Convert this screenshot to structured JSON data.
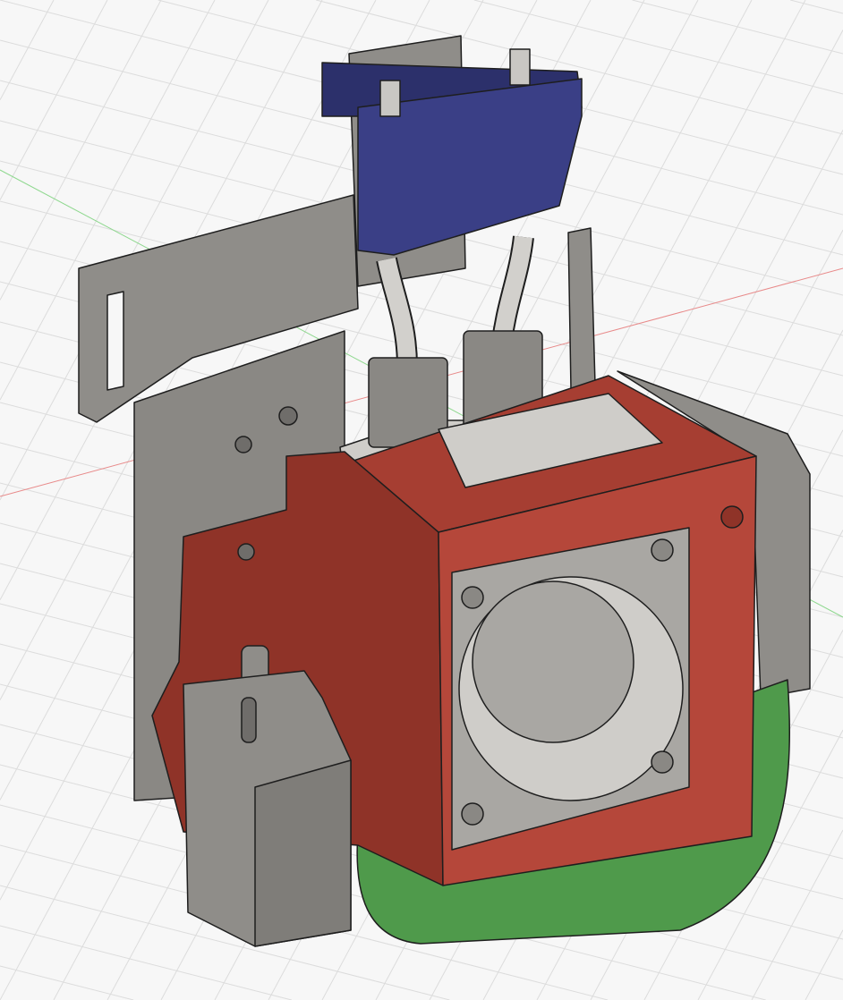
{
  "viewport": {
    "background": "#f7f7f7",
    "grid_color": "#dcdcdc",
    "x_axis_color": "#e88a8a",
    "y_axis_color": "#8fd88f"
  },
  "model": {
    "colors": {
      "plate_grey": "#8f8d89",
      "plate_grey_dark": "#6f6d6a",
      "blue_clamp": "#3a3f86",
      "blue_clamp_dark": "#2c306b",
      "red_shroud": "#b5473a",
      "red_shroud_dark": "#8f3328",
      "green_duct": "#4f9a4b",
      "fan_grey": "#a9a7a3",
      "tube_grey": "#d2d0cc",
      "edge": "#1e1e1e"
    }
  }
}
